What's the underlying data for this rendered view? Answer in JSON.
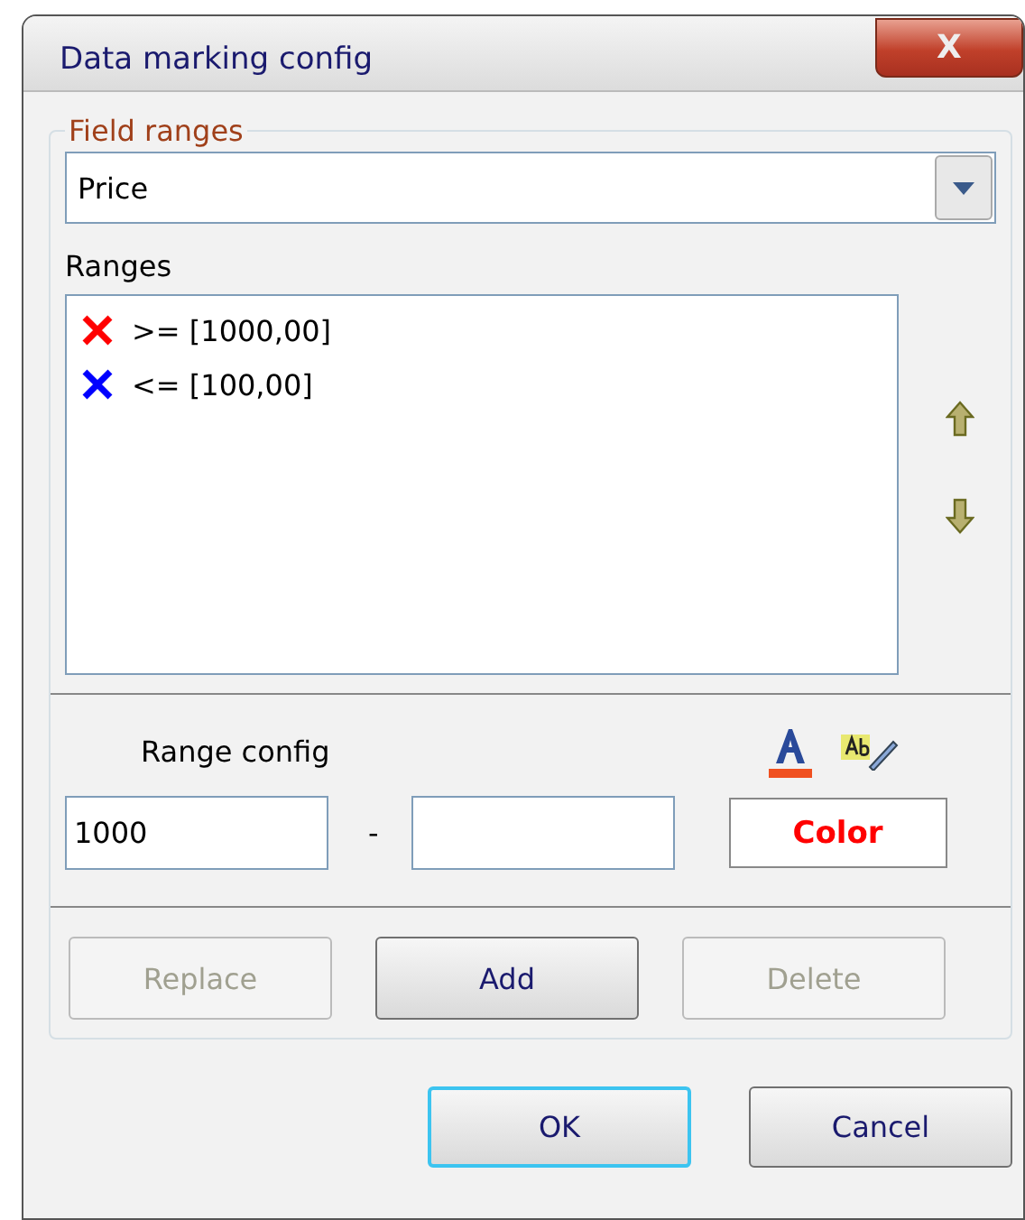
{
  "window": {
    "title": "Data marking config",
    "close": "X"
  },
  "field_ranges": {
    "legend": "Field ranges",
    "field": {
      "value": "Price"
    }
  },
  "ranges": {
    "label": "Ranges",
    "items": [
      {
        "text": ">= [1000,00]",
        "color": "#ff0000",
        "selected": false
      },
      {
        "text": "<= [100,00]",
        "color": "#0000ff",
        "selected": false
      }
    ]
  },
  "range_config": {
    "label": "Range config",
    "from": {
      "value": "1000"
    },
    "separator": "-",
    "color_button": {
      "label": "Color",
      "color": "#ff0000"
    }
  },
  "actions": [
    {
      "label": "Replace",
      "disabled": true
    },
    {
      "label": "Add",
      "disabled": false
    },
    {
      "label": "Delete",
      "disabled": true
    }
  ],
  "dialog_buttons": [
    {
      "label": "OK",
      "focused": true
    },
    {
      "label": "Cancel",
      "focused": false
    }
  ]
}
